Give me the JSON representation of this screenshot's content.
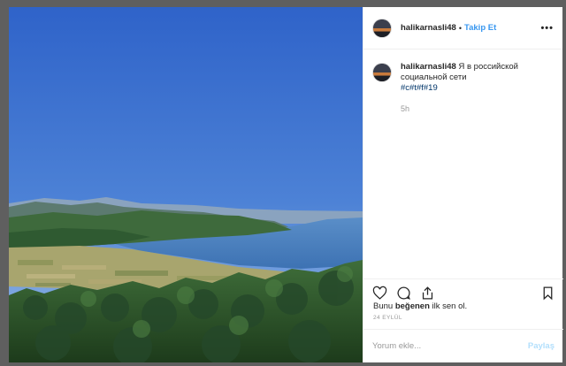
{
  "post": {
    "username": "halikarnasli48",
    "header_separator": "•",
    "follow_label": "Takip Et",
    "more_icon": "more-horizontal-icon",
    "avatar_icon": "sunset-avatar"
  },
  "caption": {
    "username": "halikarnasli48",
    "text": "Я в российской социальной сети",
    "tags": "#c#t#f#19",
    "time": "5h"
  },
  "actions": {
    "like_icon": "heart-icon",
    "comment_icon": "comment-icon",
    "share_icon": "share-icon",
    "save_icon": "bookmark-icon"
  },
  "likes": {
    "prefix": "Bunu ",
    "bold": "beğenen",
    "suffix": " ilk sen ol."
  },
  "date": "24 EYLÜL",
  "comment": {
    "placeholder": "Yorum ekle...",
    "post_label": "Paylaş"
  },
  "colors": {
    "accent": "#3897f0",
    "sky": "#3a6fcf",
    "sea": "#4a86c9",
    "backdrop": "#5f5f5f"
  }
}
